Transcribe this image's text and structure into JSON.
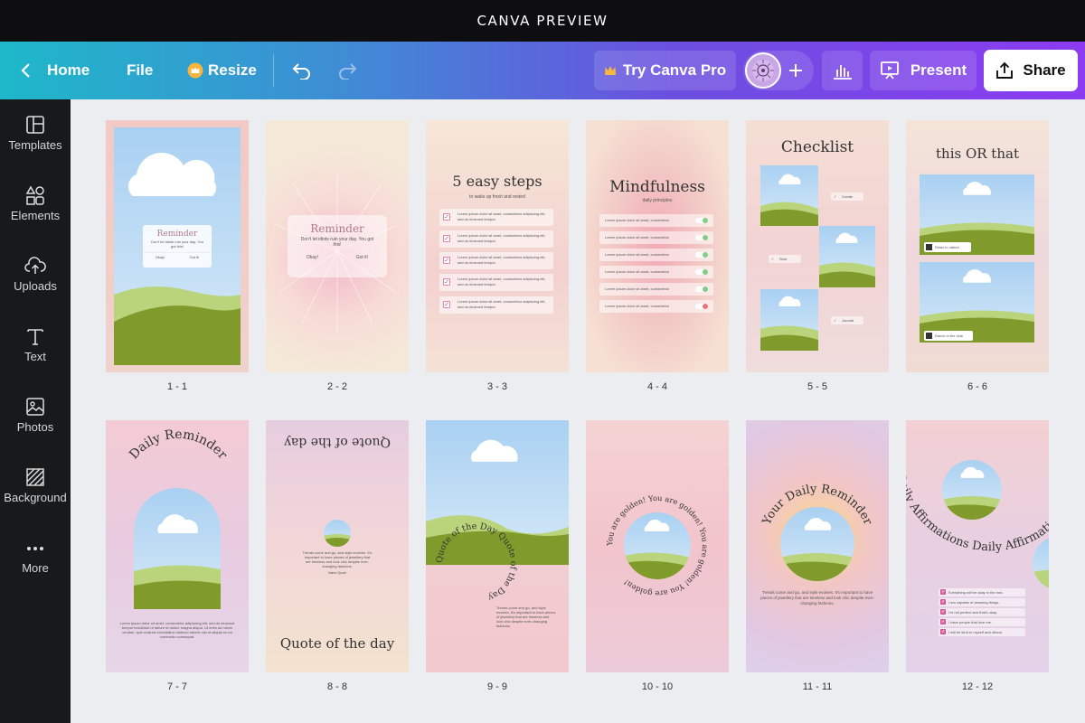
{
  "banner": {
    "title": "CANVA PREVIEW"
  },
  "toolbar": {
    "home": "Home",
    "file": "File",
    "resize": "Resize",
    "try_pro": "Try Canva Pro",
    "present": "Present",
    "share": "Share"
  },
  "sidebar": {
    "items": [
      {
        "label": "Templates",
        "icon": "templates-icon"
      },
      {
        "label": "Elements",
        "icon": "elements-icon"
      },
      {
        "label": "Uploads",
        "icon": "uploads-icon"
      },
      {
        "label": "Text",
        "icon": "text-icon"
      },
      {
        "label": "Photos",
        "icon": "photos-icon"
      },
      {
        "label": "Background",
        "icon": "background-icon"
      },
      {
        "label": "More",
        "icon": "more-icon"
      }
    ]
  },
  "pages": [
    {
      "label": "1 - 1",
      "title": "Reminder",
      "body": "Don't let idiots ruin your day. You got this!",
      "btn1": "Okay!",
      "btn2": "Got it!"
    },
    {
      "label": "2 - 2",
      "title": "Reminder",
      "body": "Don't let idiots ruin your day. You got this!",
      "btn1": "Okay!",
      "btn2": "Got it!"
    },
    {
      "label": "3 - 3",
      "title": "5 easy steps",
      "subtitle": "to wake up fresh and rested",
      "row": "Lorem ipsum dolor sit amet, consectetur adipiscing elit, sed do eiusmod tempor."
    },
    {
      "label": "4 - 4",
      "title": "Mindfulness",
      "subtitle": "daily principles",
      "row": "Lorem ipsum dolor sit amet, consectetur"
    },
    {
      "label": "5 - 5",
      "title": "Checklist",
      "items": [
        "Create",
        "Rest",
        "Journal"
      ]
    },
    {
      "label": "6 - 6",
      "title": "this OR that",
      "items": [
        "Relax in nature",
        "Dance in the club"
      ]
    },
    {
      "label": "7 - 7",
      "title": "Daily Reminder",
      "body": "Lorem ipsum dolor sit amet, consectetur adipiscing elit, sed do eiusmod tempor incididunt ut labore et dolore magna aliqua. Ut enim ad minim veniam, quis nostrud exercitation ullamco laboris nisi ut aliquip ex ea commodo consequat."
    },
    {
      "label": "8 - 8",
      "title_top": "Quote of the day",
      "title_bottom": "Quote of the day",
      "body": "Trends come and go, and style evolves. It's important to have pieces of jewellery that are timeless and look chic despite ever-changing fashions.",
      "author": "Name Quote"
    },
    {
      "label": "9 - 9",
      "title": "Quote of the Day Quote of the Day",
      "body": "Trends come and go, and style evolves. It's important to have pieces of jewellery that are timeless and look chic despite ever-changing fashions."
    },
    {
      "label": "10 - 10",
      "title": "You are golden! You are golden! You are golden! You are golden!"
    },
    {
      "label": "11 - 11",
      "title": "Your Daily Reminder",
      "body": "Trends come and go, and style evolves. It's important to have pieces of jewellery that are timeless and look chic despite ever-changing fashions."
    },
    {
      "label": "12 - 12",
      "title": "Daily Affirmations Daily Affirmations",
      "items": [
        "Everything will be okay in the end.",
        "I am capable of amazing things.",
        "I'm not perfect and that's okay.",
        "I have people that love me.",
        "I will be kind to myself and others."
      ]
    }
  ],
  "colors": {
    "accent_start": "#1eb8c9",
    "accent_end": "#8c3bf0",
    "sidebar": "#18191b",
    "canvas": "#ecedf1"
  }
}
